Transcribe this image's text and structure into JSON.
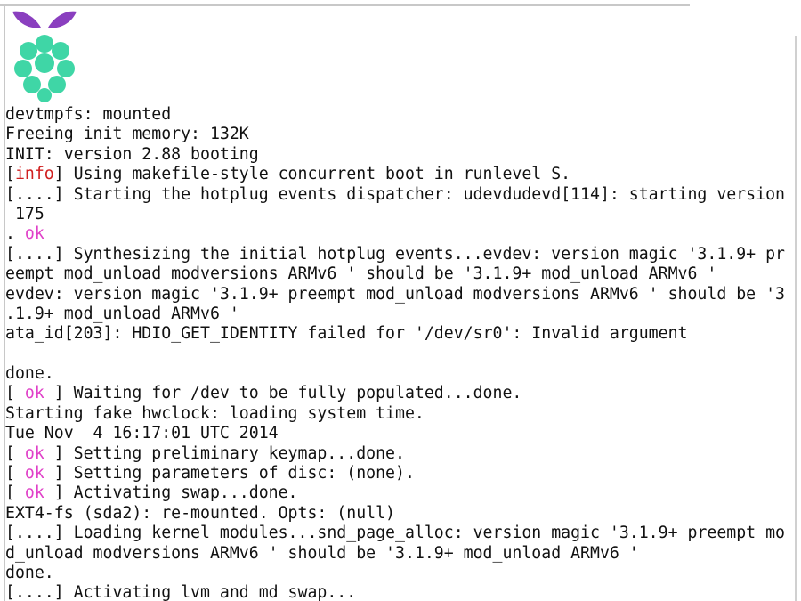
{
  "colors": {
    "background": "#ffffff",
    "text": "#111111",
    "ok": "#e040c8",
    "info": "#d02020",
    "logo_leaves": "#8a3fbf",
    "logo_berry": "#3fd6a6"
  },
  "logo": {
    "icon": "raspberry-pi-logo-icon"
  },
  "console_lines": [
    {
      "parts": [
        {
          "text": "devtmpfs: mounted"
        }
      ]
    },
    {
      "parts": [
        {
          "text": "Freeing init memory: 132K"
        }
      ]
    },
    {
      "parts": [
        {
          "text": "INIT: version 2.88 booting"
        }
      ]
    },
    {
      "parts": [
        {
          "text": "["
        },
        {
          "text": "info",
          "tag": "info"
        },
        {
          "text": "] Using makefile-style concurrent boot in runlevel S."
        }
      ]
    },
    {
      "parts": [
        {
          "text": "[....] Starting the hotplug events dispatcher: udevdudevd[114]: starting version"
        }
      ]
    },
    {
      "parts": [
        {
          "text": " 175"
        }
      ]
    },
    {
      "parts": [
        {
          "text": ". "
        },
        {
          "text": "ok",
          "tag": "ok"
        }
      ]
    },
    {
      "parts": [
        {
          "text": "[....] Synthesizing the initial hotplug events...evdev: version magic '3.1.9+ pr"
        }
      ]
    },
    {
      "parts": [
        {
          "text": "eempt mod_unload modversions ARMv6 ' should be '3.1.9+ mod_unload ARMv6 '"
        }
      ]
    },
    {
      "parts": [
        {
          "text": "evdev: version magic '3.1.9+ preempt mod_unload modversions ARMv6 ' should be '3"
        }
      ]
    },
    {
      "parts": [
        {
          "text": ".1.9+ mod_unload ARMv6 '"
        }
      ]
    },
    {
      "parts": [
        {
          "text": "ata_id[203]: HDIO_GET_IDENTITY failed for '/dev/sr0': Invalid argument"
        }
      ]
    },
    {
      "parts": [
        {
          "text": ""
        }
      ]
    },
    {
      "parts": [
        {
          "text": "done."
        }
      ]
    },
    {
      "parts": [
        {
          "text": "[ "
        },
        {
          "text": "ok",
          "tag": "ok"
        },
        {
          "text": " ] Waiting for /dev to be fully populated...done."
        }
      ]
    },
    {
      "parts": [
        {
          "text": "Starting fake hwclock: loading system time."
        }
      ]
    },
    {
      "parts": [
        {
          "text": "Tue Nov  4 16:17:01 UTC 2014"
        }
      ]
    },
    {
      "parts": [
        {
          "text": "[ "
        },
        {
          "text": "ok",
          "tag": "ok"
        },
        {
          "text": " ] Setting preliminary keymap...done."
        }
      ]
    },
    {
      "parts": [
        {
          "text": "[ "
        },
        {
          "text": "ok",
          "tag": "ok"
        },
        {
          "text": " ] Setting parameters of disc: (none)."
        }
      ]
    },
    {
      "parts": [
        {
          "text": "[ "
        },
        {
          "text": "ok",
          "tag": "ok"
        },
        {
          "text": " ] Activating swap...done."
        }
      ]
    },
    {
      "parts": [
        {
          "text": "EXT4-fs (sda2): re-mounted. Opts: (null)"
        }
      ]
    },
    {
      "parts": [
        {
          "text": "[....] Loading kernel modules...snd_page_alloc: version magic '3.1.9+ preempt mo"
        }
      ]
    },
    {
      "parts": [
        {
          "text": "d_unload modversions ARMv6 ' should be '3.1.9+ mod_unload ARMv6 '"
        }
      ]
    },
    {
      "parts": [
        {
          "text": "done."
        }
      ]
    },
    {
      "parts": [
        {
          "text": "[....] Activating lvm and md swap..."
        }
      ]
    }
  ]
}
